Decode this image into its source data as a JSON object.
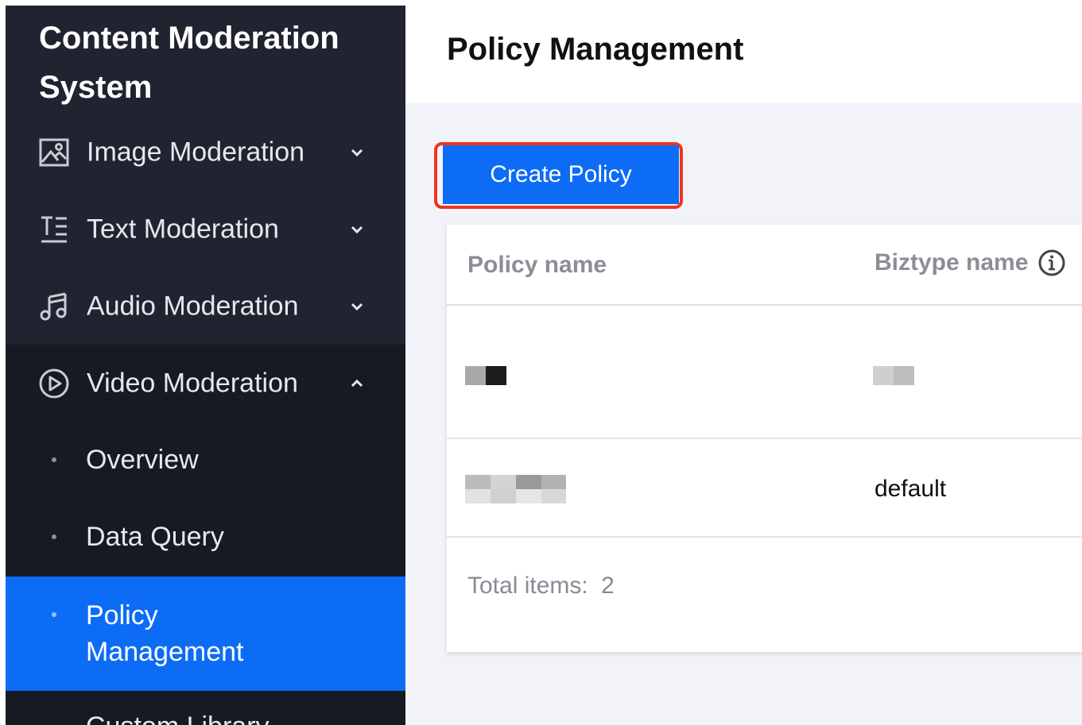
{
  "sidebar": {
    "app_title": "Content Moderation System",
    "items": [
      {
        "label": "Image Moderation",
        "icon": "image-icon",
        "expanded": false
      },
      {
        "label": "Text Moderation",
        "icon": "text-icon",
        "expanded": false
      },
      {
        "label": "Audio Moderation",
        "icon": "music-icon",
        "expanded": false
      },
      {
        "label": "Video Moderation",
        "icon": "play-circle-icon",
        "expanded": true
      }
    ],
    "sub_items": [
      {
        "label": "Overview",
        "active": false
      },
      {
        "label": "Data Query",
        "active": false
      },
      {
        "label": "Policy Management",
        "active": true
      },
      {
        "label": "Custom Library",
        "active": false
      }
    ]
  },
  "header": {
    "title": "Policy Management"
  },
  "toolbar": {
    "create_label": "Create Policy"
  },
  "table": {
    "columns": [
      "Policy name",
      "Biztype name"
    ],
    "rows": [
      {
        "policy_name": "",
        "biztype_name": ""
      },
      {
        "policy_name": "",
        "biztype_name": "default"
      }
    ],
    "total_label": "Total items:",
    "total_count": "2"
  },
  "colors": {
    "sidebar_bg": "#202430",
    "submenu_bg": "#171a22",
    "accent": "#0d6cf5",
    "highlight_outline": "#f0331f"
  }
}
